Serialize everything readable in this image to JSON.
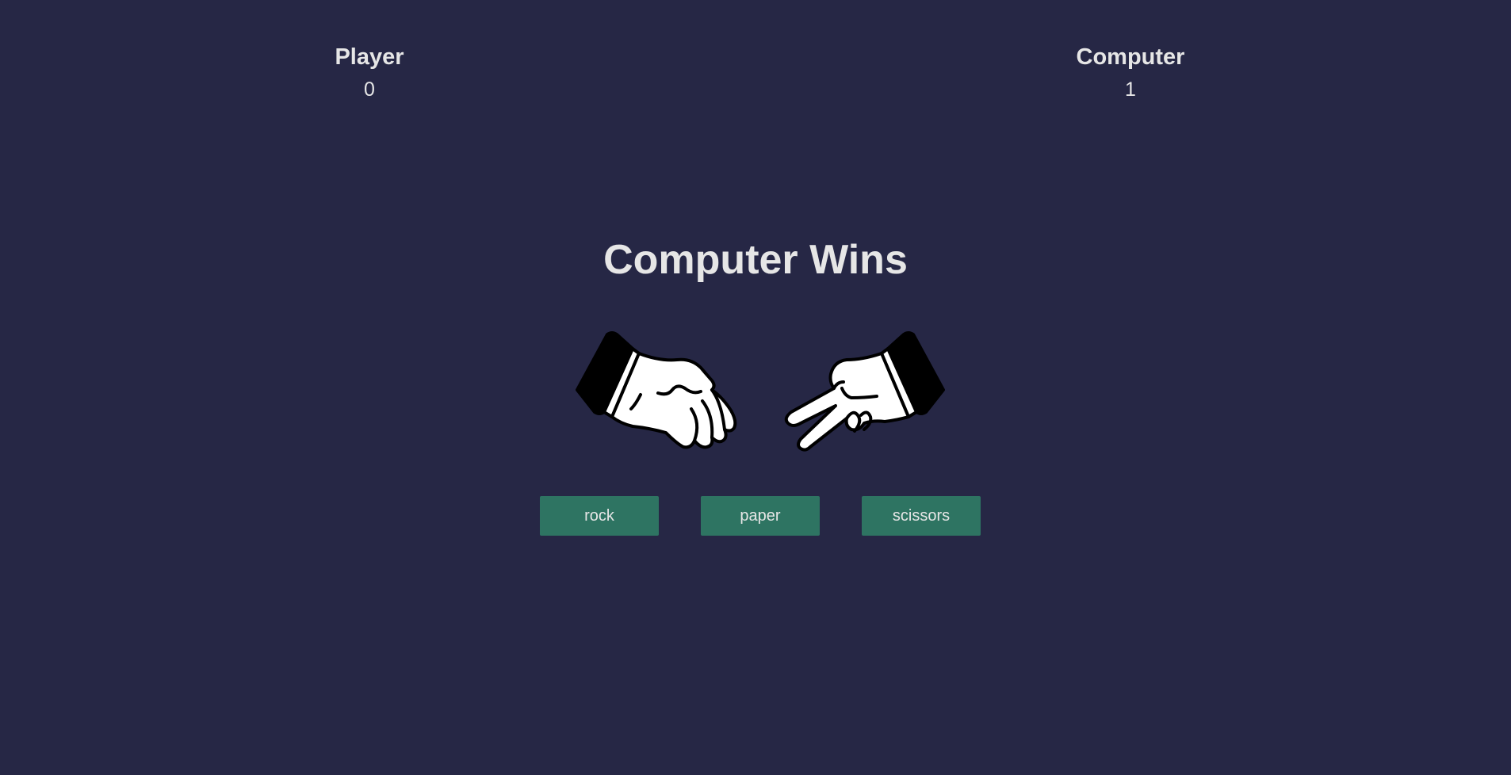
{
  "scoreboard": {
    "player": {
      "label": "Player",
      "score": "0"
    },
    "computer": {
      "label": "Computer",
      "score": "1"
    }
  },
  "result": {
    "text": "Computer Wins"
  },
  "hands": {
    "player": {
      "choice": "paper",
      "icon": "paper-hand-icon"
    },
    "computer": {
      "choice": "scissors",
      "icon": "scissors-hand-icon"
    }
  },
  "choices": [
    {
      "label": "rock"
    },
    {
      "label": "paper"
    },
    {
      "label": "scissors"
    }
  ],
  "colors": {
    "background": "#262745",
    "text": "#e6e6e6",
    "button": "#2e7462"
  }
}
